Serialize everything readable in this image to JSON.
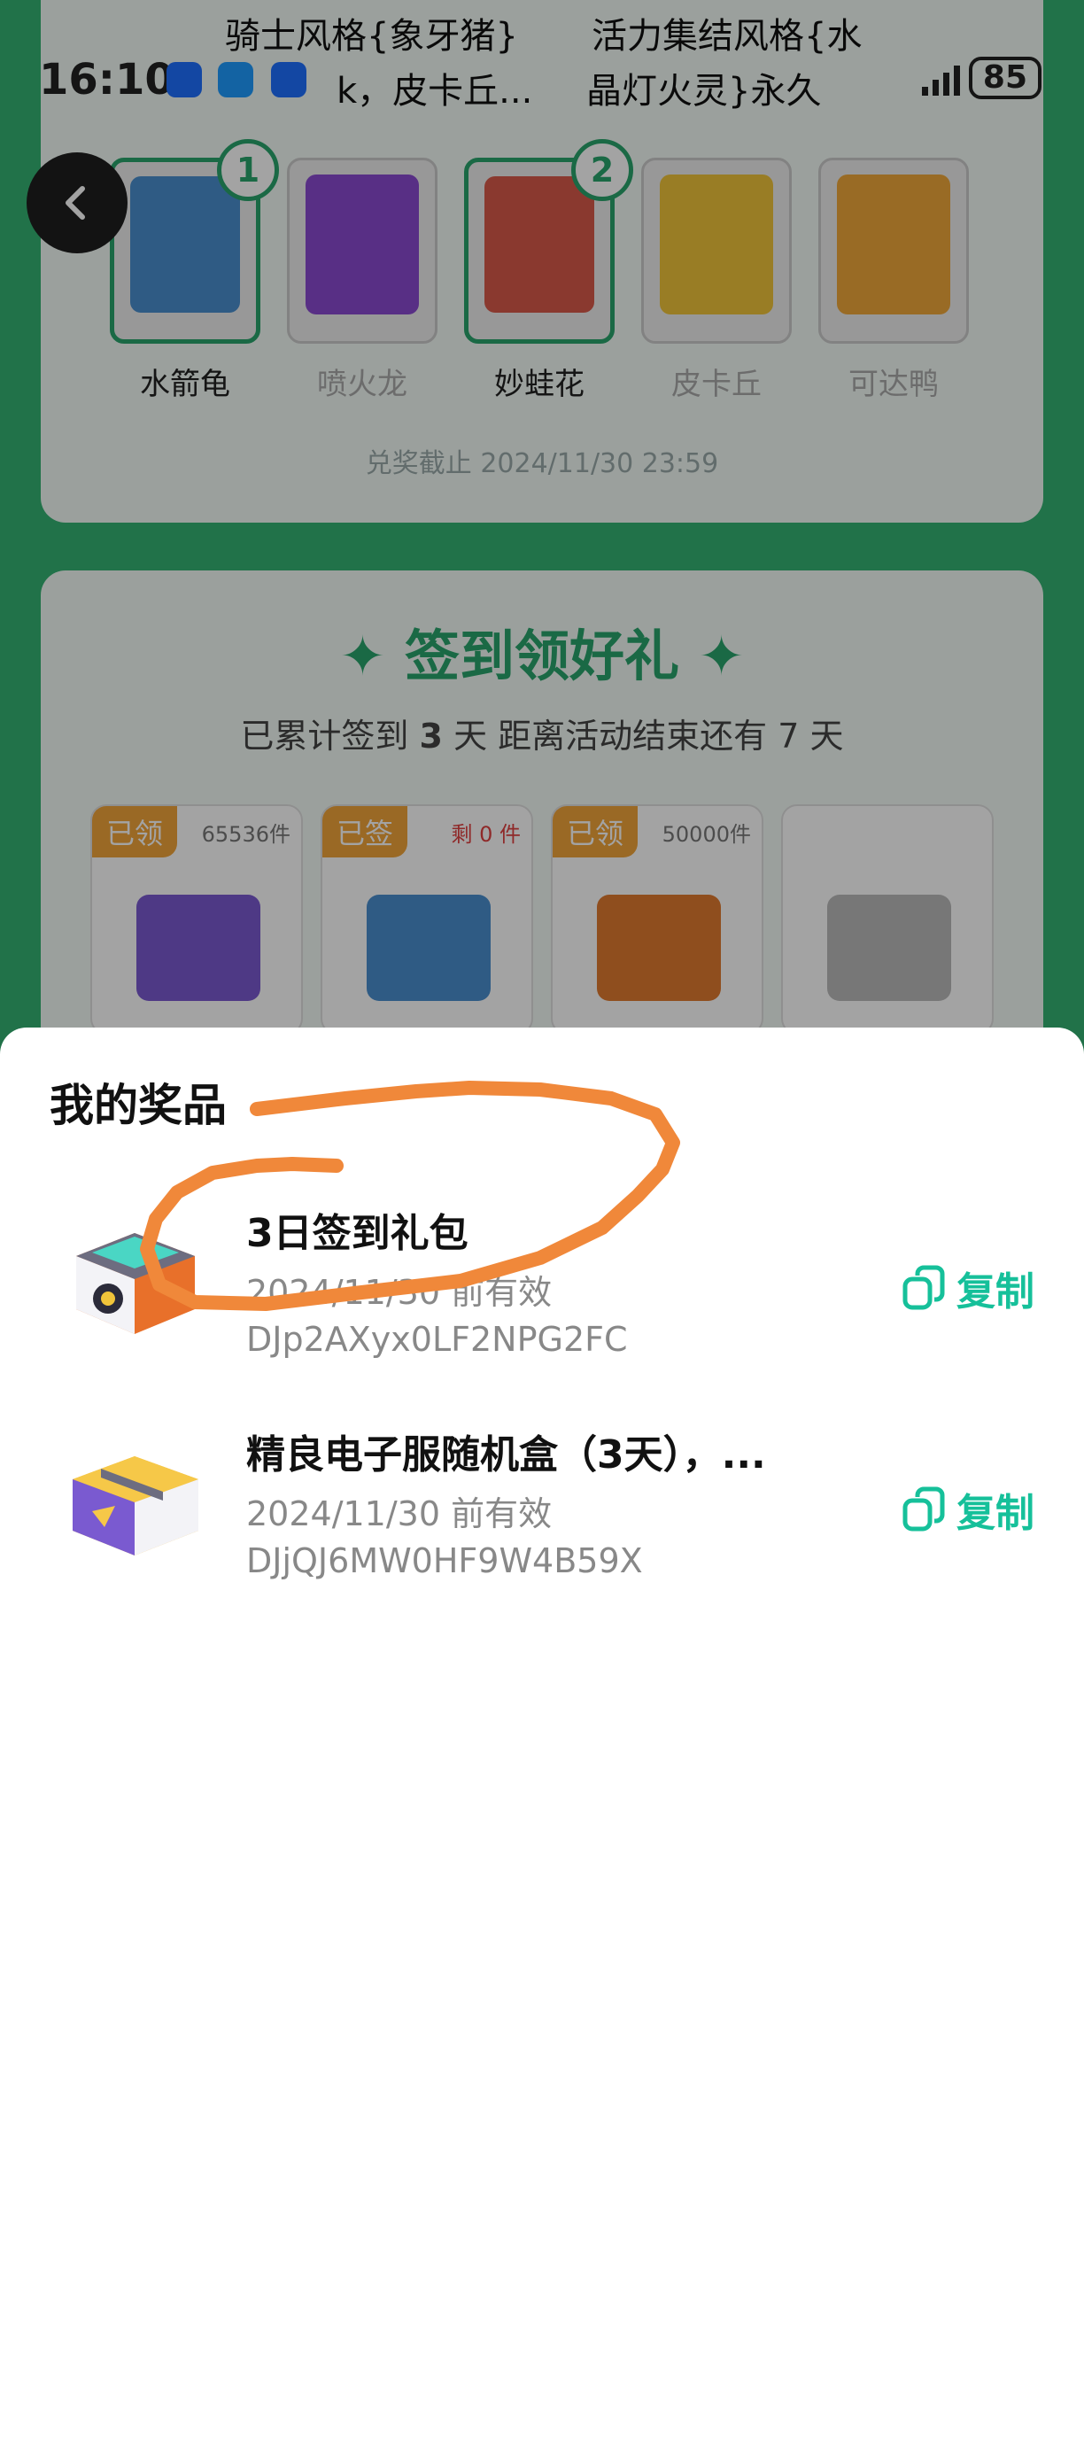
{
  "status_bar": {
    "time": "16:10",
    "battery": "85",
    "notifications": [
      {
        "line1": "骑士风格{象牙猪}",
        "line2": "k，皮卡丘..."
      },
      {
        "line1": "活力集结风格{水",
        "line2": "晶灯火灵}永久"
      }
    ]
  },
  "pokemon_cards": [
    {
      "name": "水箭龟",
      "selected": true,
      "badge": "1",
      "color": "#4a8fcf"
    },
    {
      "name": "喷火龙",
      "selected": false,
      "badge": "",
      "color": "#8a4ad0"
    },
    {
      "name": "妙蛙花",
      "selected": true,
      "badge": "2",
      "color": "#d85a4a"
    },
    {
      "name": "皮卡丘",
      "selected": false,
      "badge": "",
      "color": "#f0c43a"
    },
    {
      "name": "可达鸭",
      "selected": false,
      "badge": "",
      "color": "#f0a83a"
    }
  ],
  "deadline": "兑奖截止 2024/11/30 23:59",
  "sign_in": {
    "title": "签到领好礼",
    "subtitle_prefix": "已累计签到",
    "days": "3",
    "subtitle_mid": "天  距离活动结束还有",
    "remaining": "7",
    "subtitle_suffix": "天",
    "rewards": [
      {
        "tag": "已领",
        "count": "65536件",
        "count_red": false,
        "color": "#7a5ad0"
      },
      {
        "tag": "已签",
        "count": "剩 0 件",
        "count_red": true,
        "color": "#4a8fcf"
      },
      {
        "tag": "已领",
        "count": "50000件",
        "count_red": false,
        "color": "#e07a30"
      },
      {
        "tag": "",
        "count": "",
        "count_red": false,
        "color": "#bbbbbb"
      }
    ]
  },
  "sheet": {
    "title": "我的奖品",
    "prizes": [
      {
        "name": "3日签到礼包",
        "valid": "2024/11/30 前有效",
        "code": "DJp2AXyx0LF2NPG2FC",
        "copy_label": "复制"
      },
      {
        "name": "精良电子服随机盒（3天），...",
        "valid": "2024/11/30 前有效",
        "code": "DJjQJ6MW0HF9W4B59X",
        "copy_label": "复制"
      }
    ]
  },
  "colors": {
    "accent": "#2aa56c",
    "copy": "#16c09a",
    "annotation": "#f0883a"
  }
}
